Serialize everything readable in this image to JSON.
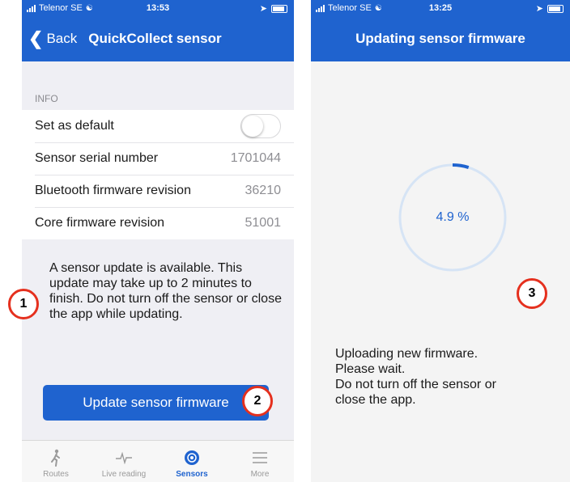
{
  "left_screen": {
    "status": {
      "carrier": "Telenor SE",
      "time": "13:53"
    },
    "nav": {
      "back_label": "Back",
      "title": "QuickCollect sensor"
    },
    "section_header": "INFO",
    "rows": [
      {
        "label": "Set as default",
        "toggle_on": false
      },
      {
        "label": "Sensor serial number",
        "value": "1701044"
      },
      {
        "label": "Bluetooth firmware revision",
        "value": "36210"
      },
      {
        "label": "Core firmware revision",
        "value": "51001"
      }
    ],
    "update_message": "A sensor update is available. This update may take up to 2 minutes to finish. Do not turn off the sensor or close the app while updating.",
    "update_button_label": "Update sensor firmware",
    "tabs": [
      {
        "label": "Routes",
        "icon": "walking-person-icon",
        "active": false
      },
      {
        "label": "Live reading",
        "icon": "pulse-icon",
        "active": false
      },
      {
        "label": "Sensors",
        "icon": "sensor-icon",
        "active": true
      },
      {
        "label": "More",
        "icon": "menu-icon",
        "active": false
      }
    ]
  },
  "right_screen": {
    "status": {
      "carrier": "Telenor SE",
      "time": "13:25"
    },
    "nav": {
      "title": "Updating sensor firmware"
    },
    "progress": {
      "percent": 4.9,
      "label": "4.9 %"
    },
    "message_lines": [
      "Uploading new firmware.",
      "Please wait.",
      "Do not turn off the sensor or",
      "close the app."
    ]
  },
  "callouts": [
    "1",
    "2",
    "3"
  ],
  "colors": {
    "primary": "#1f63cf",
    "callout_border": "#e5301e",
    "progress_track": "#d6e4f5"
  }
}
